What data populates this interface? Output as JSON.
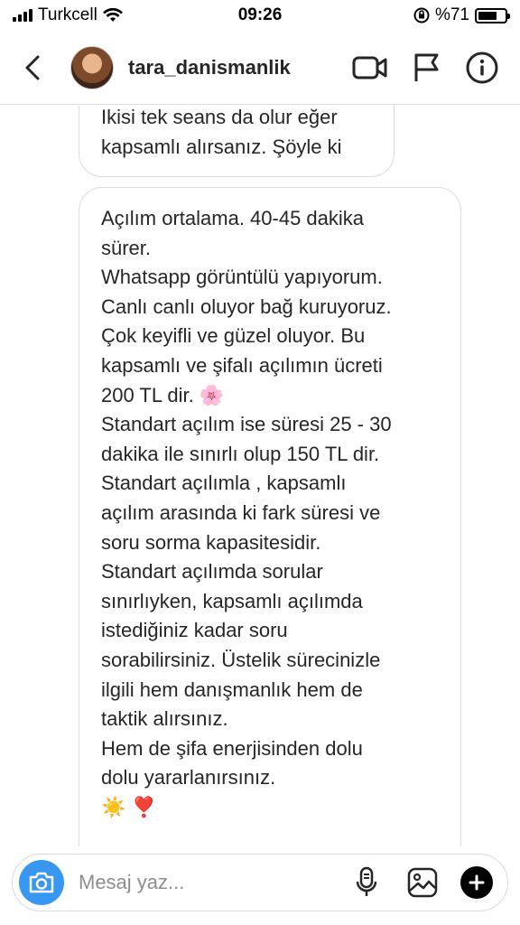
{
  "status_bar": {
    "carrier": "Turkcell",
    "time": "09:26",
    "battery": "%71",
    "battery_level": 0.71
  },
  "header": {
    "username": "tara_danismanlik",
    "icons": [
      "chevron-left-icon",
      "video-camera-icon",
      "flag-icon",
      "info-icon"
    ]
  },
  "messages": [
    {
      "text": "Ikisi tek seans da olur eğer\nkapsamlı alırsanız. Şöyle ki"
    },
    {
      "text": "Açılım ortalama. 40-45 dakika\nsürer.\nWhatsapp görüntülü yapıyorum.\nCanlı canlı oluyor bağ kuruyoruz.\nÇok keyifli ve güzel oluyor. Bu\nkapsamlı ve şifalı açılımın ücreti\n200 TL dir. 🌸\nStandart açılım ise süresi 25 - 30\ndakika ile sınırlı olup 150 TL dir.\nStandart açılımla , kapsamlı\naçılım arasında ki fark süresi ve\nsoru sorma kapasitesidir.\nStandart açılımda sorular\nsınırlıyken, kapsamlı açılımda\nistediğiniz kadar soru\nsorabilirsiniz. Üstelik sürecinizle\nilgili hem danışmanlık hem de\ntaktik alırsınız.\nHem de şifa enerjisinden dolu\ndolu yararlanırsınız.\n☀️ ❣️"
    }
  ],
  "composer": {
    "placeholder": "Mesaj yaz...",
    "icons": [
      "camera-icon",
      "microphone-icon",
      "gallery-icon",
      "plus-icon"
    ]
  },
  "colors": {
    "accent": "#3897f0",
    "border": "#dbdbdb",
    "text": "#262626"
  }
}
